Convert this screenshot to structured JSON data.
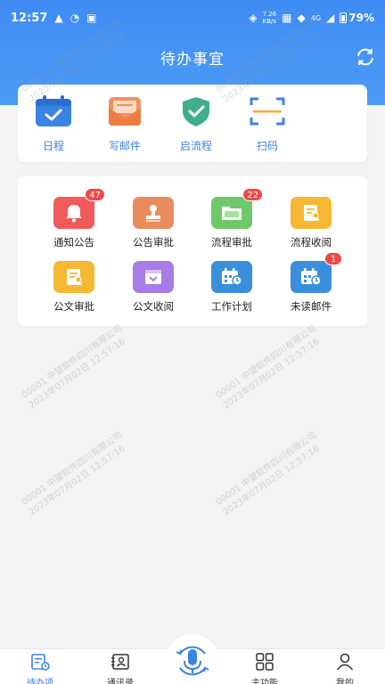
{
  "status": {
    "time": "12:57",
    "speed_value": "7.26",
    "speed_unit": "KB/s",
    "network": "4G",
    "battery": "79%"
  },
  "header": {
    "title": "待办事宜"
  },
  "quick_actions": [
    {
      "label": "日程",
      "icon": "calendar-icon"
    },
    {
      "label": "写邮件",
      "icon": "mail-icon"
    },
    {
      "label": "启流程",
      "icon": "shield-check-icon"
    },
    {
      "label": "扫码",
      "icon": "scan-icon"
    }
  ],
  "apps": [
    {
      "label": "通知公告",
      "badge": "47",
      "color": "#f05a5a",
      "icon": "bell-icon"
    },
    {
      "label": "公告审批",
      "badge": "",
      "color": "#e98b5c",
      "icon": "stamp-icon"
    },
    {
      "label": "流程审批",
      "badge": "22",
      "color": "#6fc96b",
      "icon": "folder-icon"
    },
    {
      "label": "流程收阅",
      "badge": "",
      "color": "#f6b733",
      "icon": "document-user-icon"
    },
    {
      "label": "公文审批",
      "badge": "",
      "color": "#f6b733",
      "icon": "document-user-icon"
    },
    {
      "label": "公文收阅",
      "badge": "",
      "color": "#a77ce6",
      "icon": "inbox-icon"
    },
    {
      "label": "工作计划",
      "badge": "",
      "color": "#3a8fdc",
      "icon": "calendar-clock-icon"
    },
    {
      "label": "未读邮件",
      "badge": "1",
      "color": "#3a8fdc",
      "icon": "calendar-clock-icon"
    }
  ],
  "watermark": {
    "line1": "00001 中望软件四川有限公司",
    "line2": "2023年07月02日 12:57:16"
  },
  "tabbar": {
    "items": [
      {
        "label": "待办项",
        "icon": "todo-icon"
      },
      {
        "label": "通讯录",
        "icon": "contacts-icon"
      },
      {
        "label": "主功能",
        "icon": "grid-icon"
      },
      {
        "label": "我的",
        "icon": "person-icon"
      }
    ],
    "center_icon": "microphone-icon"
  },
  "colors": {
    "brand_blue": "#3e8bf3",
    "accent_text": "#3a83e6",
    "badge_red": "#f04848"
  }
}
